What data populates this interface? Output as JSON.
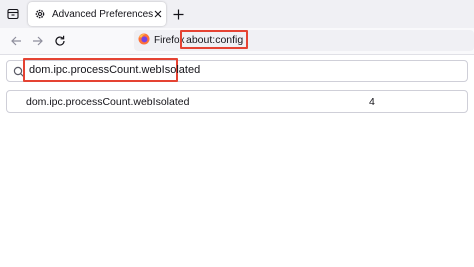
{
  "browser": {
    "tab": {
      "title": "Advanced Preferences",
      "icon": "gear-icon"
    },
    "nav": {
      "identity_label": "Firefox",
      "url": "about:config"
    },
    "colors": {
      "highlight": "#e54333",
      "tabbar_bg": "#f0f0f4",
      "text": "#15141a"
    }
  },
  "config": {
    "search": {
      "value": "dom.ipc.processCount.webIsolated"
    },
    "rows": [
      {
        "name": "dom.ipc.processCount.webIsolated",
        "value": "4"
      }
    ]
  }
}
